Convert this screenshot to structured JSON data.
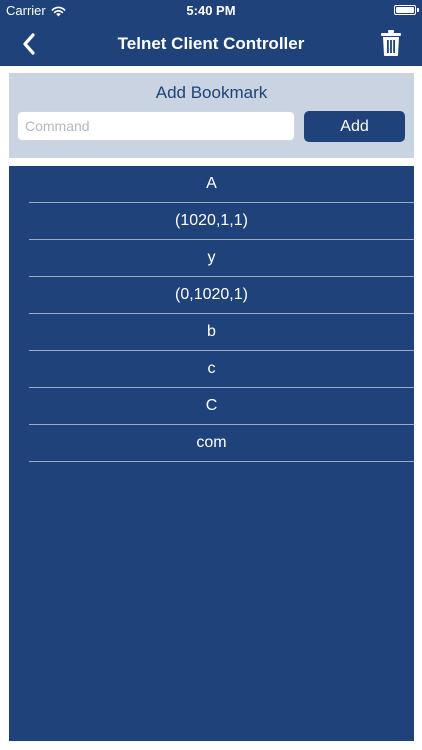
{
  "status_bar": {
    "carrier": "Carrier",
    "time": "5:40 PM"
  },
  "nav": {
    "title": "Telnet Client Controller",
    "back_icon": "chevron-left-icon",
    "trash_icon": "trash-icon"
  },
  "add_panel": {
    "title": "Add Bookmark",
    "command_placeholder": "Command",
    "command_value": "",
    "add_label": "Add"
  },
  "bookmarks": [
    {
      "label": "A"
    },
    {
      "label": "(1020,1,1)"
    },
    {
      "label": "y"
    },
    {
      "label": "(0,1020,1)"
    },
    {
      "label": "b"
    },
    {
      "label": "c"
    },
    {
      "label": "C"
    },
    {
      "label": "com"
    }
  ],
  "colors": {
    "brand": "#1e4279",
    "panel": "#c9d3e1",
    "separator": "#9aa9c3"
  }
}
